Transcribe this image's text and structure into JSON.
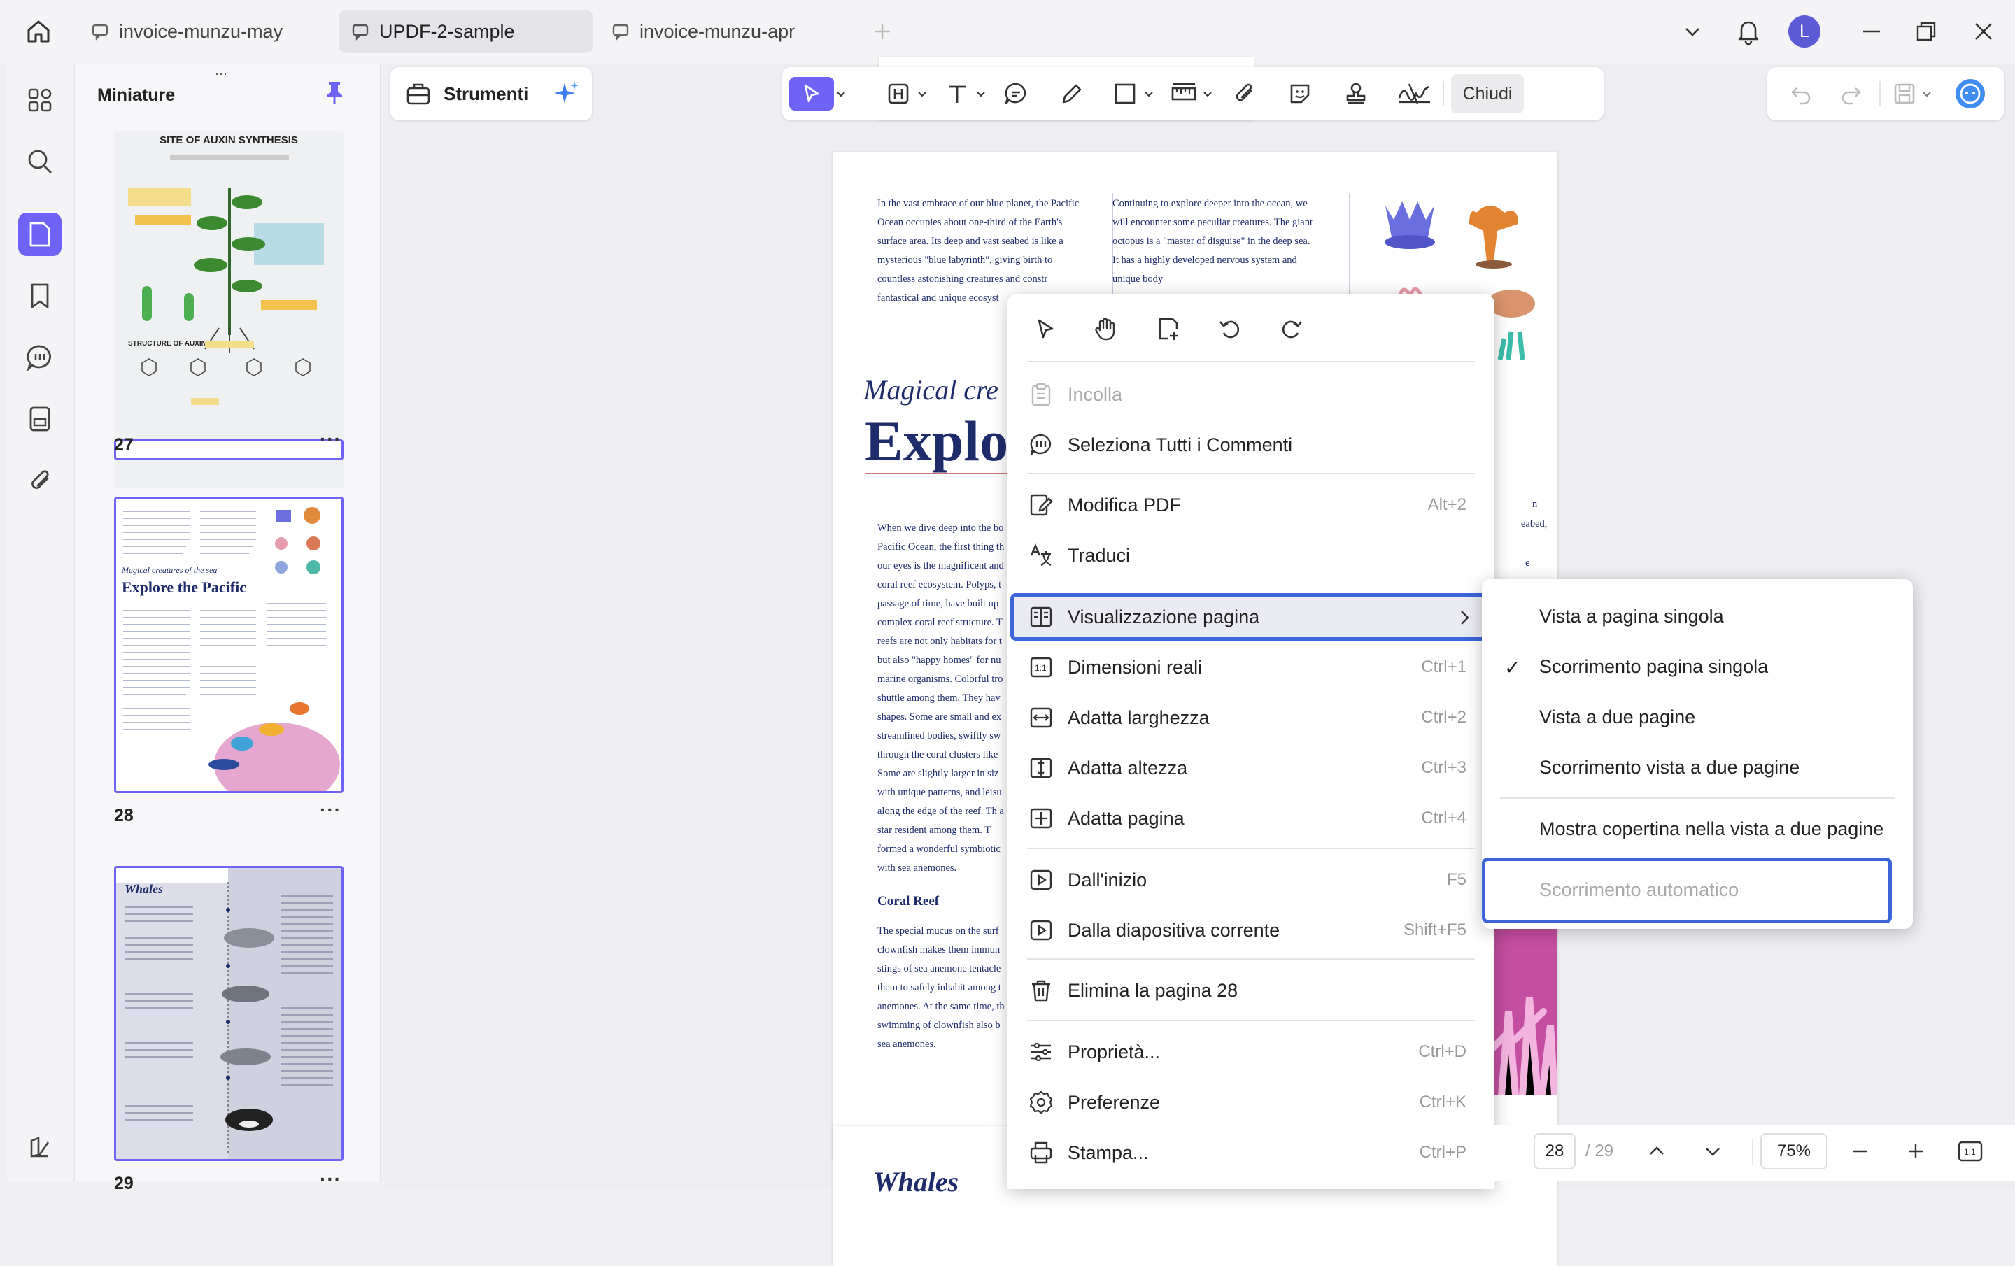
{
  "tabs": [
    {
      "label": "invoice-munzu-may",
      "active": false
    },
    {
      "label": "UPDF-2-sample",
      "active": true
    },
    {
      "label": "invoice-munzu-apr",
      "active": false
    }
  ],
  "user": {
    "avatar_letter": "L",
    "avatar_color": "#5b5bd6"
  },
  "thumbnails": {
    "title": "Miniature",
    "pages": [
      {
        "number": "27",
        "heading": "SITE OF AUXIN SYNTHESIS",
        "subheading": "STRUCTURE OF AUXIN"
      },
      {
        "number": "28",
        "subtitle": "Magical creatures of the sea",
        "heading": "Explore the Pacific"
      },
      {
        "number": "29",
        "heading": "Whales"
      }
    ]
  },
  "toolbar": {
    "strumenti_label": "Strumenti",
    "close_label": "Chiudi"
  },
  "page": {
    "col1": "In the vast embrace of our blue planet, the Pacific Ocean occupies about one-third of the Earth's surface area. Its deep and vast seabed is like a mysterious \"blue labyrinth\", giving birth to countless astonishing creatures and constr fantastical and unique ecosyst",
    "col2": "Continuing to explore deeper into the ocean, we will encounter some peculiar creatures. The giant octopus is a \"master of disguise\" in the deep sea. It has a highly developed nervous system and unique body",
    "subtitle": "Magical cre",
    "title": "Explo",
    "body": "When we dive deep into the bo Pacific Ocean, the first thing th our eyes is the magnificent and coral reef ecosystem. Polyps, t passage of time, have built up complex coral reef structure. T reefs are not only habitats for t but also \"happy homes\" for nu marine organisms. Colorful tro shuttle among them. They hav shapes. Some are small and ex streamlined bodies, swiftly sw through the coral clusters like Some are slightly larger in siz with unique patterns, and leisu along the edge of the reef. Th a star resident among them. T formed a wonderful symbiotic with sea anemones.",
    "coral_heading": "Coral Reef",
    "coral_body": "The special mucus on the surf clownfish makes them immun stings of sea anemone tentacle them to safely inhabit among t anemones. At the same time, th swimming of clownfish also b sea anemones.",
    "right_frag1": "n",
    "right_frag2": "eabed,",
    "right_frag3": "e",
    "next_title": "Whales"
  },
  "context_menu": {
    "items": [
      {
        "label": "Incolla",
        "shortcut": "",
        "icon": "paste-icon",
        "disabled": true
      },
      {
        "label": "Seleziona Tutti i Commenti",
        "shortcut": "",
        "icon": "comments-icon",
        "disabled": false
      },
      {
        "label": "Modifica PDF",
        "shortcut": "Alt+2",
        "icon": "edit-pdf-icon",
        "disabled": false
      },
      {
        "label": "Traduci",
        "shortcut": "",
        "icon": "translate-icon",
        "disabled": false
      },
      {
        "label": "Visualizzazione pagina",
        "shortcut": "",
        "icon": "page-view-icon",
        "disabled": false
      },
      {
        "label": "Dimensioni reali",
        "shortcut": "Ctrl+1",
        "icon": "actual-size-icon",
        "disabled": false
      },
      {
        "label": "Adatta larghezza",
        "shortcut": "Ctrl+2",
        "icon": "fit-width-icon",
        "disabled": false
      },
      {
        "label": "Adatta altezza",
        "shortcut": "Ctrl+3",
        "icon": "fit-height-icon",
        "disabled": false
      },
      {
        "label": "Adatta pagina",
        "shortcut": "Ctrl+4",
        "icon": "fit-page-icon",
        "disabled": false
      },
      {
        "label": "Dall'inizio",
        "shortcut": "F5",
        "icon": "play-start-icon",
        "disabled": false
      },
      {
        "label": "Dalla diapositiva corrente",
        "shortcut": "Shift+F5",
        "icon": "play-current-icon",
        "disabled": false
      },
      {
        "label": "Elimina la pagina 28",
        "shortcut": "",
        "icon": "trash-icon",
        "disabled": false
      },
      {
        "label": "Proprietà...",
        "shortcut": "Ctrl+D",
        "icon": "properties-icon",
        "disabled": false
      },
      {
        "label": "Preferenze",
        "shortcut": "Ctrl+K",
        "icon": "settings-icon",
        "disabled": false
      },
      {
        "label": "Stampa...",
        "shortcut": "Ctrl+P",
        "icon": "print-icon",
        "disabled": false
      }
    ]
  },
  "submenu": {
    "items": [
      {
        "label": "Vista a pagina singola",
        "checked": false
      },
      {
        "label": "Scorrimento pagina singola",
        "checked": true
      },
      {
        "label": "Vista a due pagine",
        "checked": false
      },
      {
        "label": "Scorrimento vista a due pagine",
        "checked": false
      },
      {
        "label": "Mostra copertina nella vista a due pagine",
        "checked": false
      },
      {
        "label": "Scorrimento automatico",
        "checked": false,
        "disabled": true
      }
    ],
    "check_mark": "✓"
  },
  "nav": {
    "current_page": "28",
    "total_pages": "/ 29",
    "zoom": "75%"
  },
  "colors": {
    "accent": "#6f63f5",
    "highlight_border": "#3a66d8",
    "title_navy": "#1f2c6b"
  }
}
